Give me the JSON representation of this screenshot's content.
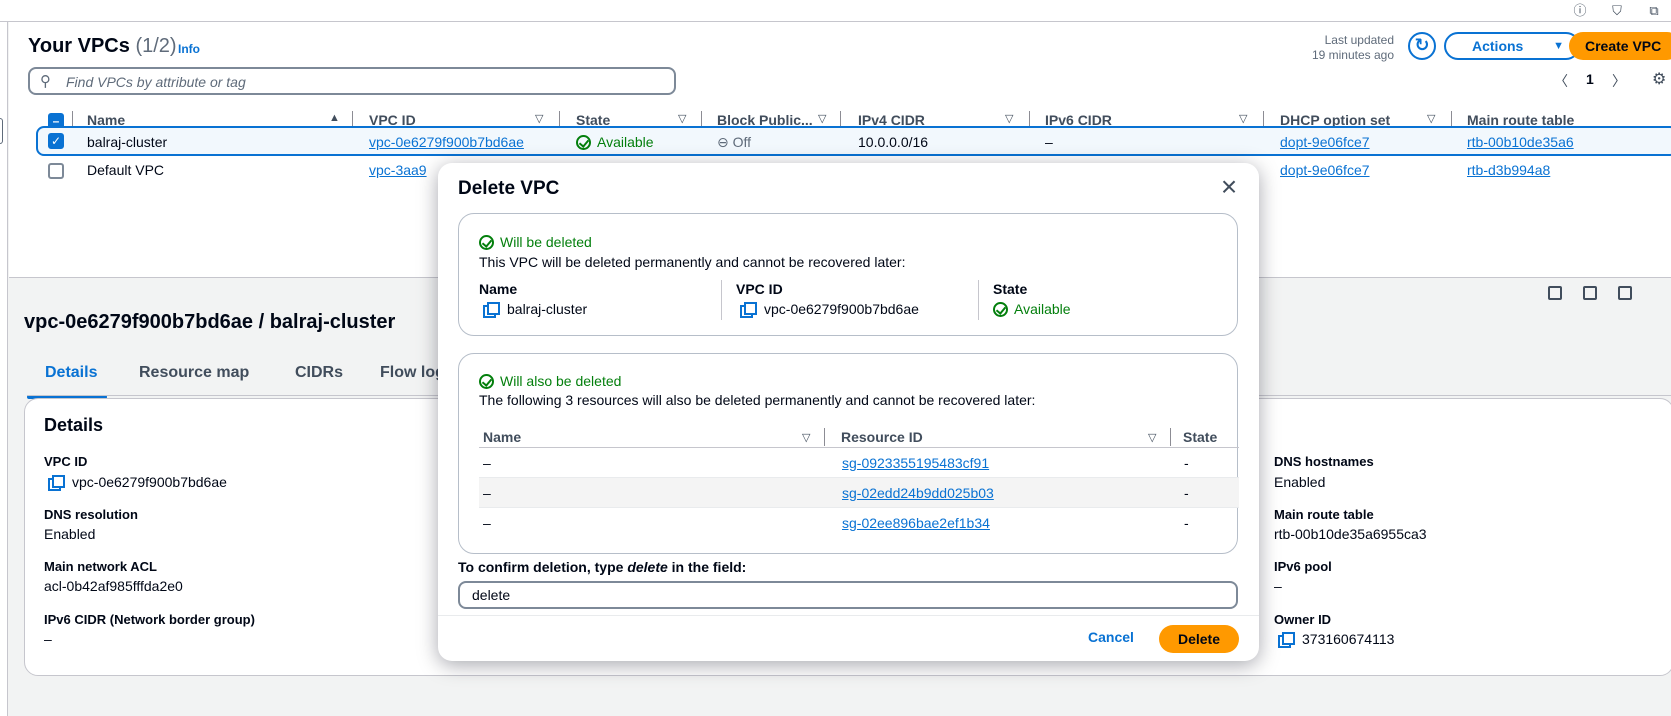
{
  "panel": {
    "title": "Your VPCs",
    "count": "(1/2)",
    "info": "Info",
    "last_updated_label": "Last updated",
    "last_updated_value": "19 minutes ago",
    "actions_label": "Actions",
    "create_label": "Create VPC",
    "search_placeholder": "Find VPCs by attribute or tag",
    "page": "1"
  },
  "table": {
    "columns": [
      "Name",
      "VPC ID",
      "State",
      "Block Public...",
      "IPv4 CIDR",
      "IPv6 CIDR",
      "DHCP option set",
      "Main route table"
    ],
    "rows": [
      {
        "selected": true,
        "name": "balraj-cluster",
        "vpc_id": "vpc-0e6279f900b7bd6ae",
        "state": "Available",
        "block": "Off",
        "ipv4": "10.0.0.0/16",
        "ipv6": "–",
        "dhcp": "dopt-9e06fce7",
        "route": "rtb-00b10de35a6"
      },
      {
        "selected": false,
        "name": "Default VPC",
        "vpc_id": "vpc-3aa9",
        "dhcp": "dopt-9e06fce7",
        "route": "rtb-d3b994a8"
      }
    ]
  },
  "detail": {
    "title": "vpc-0e6279f900b7bd6ae / balraj-cluster",
    "tabs": [
      "Details",
      "Resource map",
      "CIDRs",
      "Flow logs"
    ],
    "card_title": "Details",
    "fields": {
      "vpc_id_k": "VPC ID",
      "vpc_id_v": "vpc-0e6279f900b7bd6ae",
      "dns_res_k": "DNS resolution",
      "dns_res_v": "Enabled",
      "acl_k": "Main network ACL",
      "acl_v": "acl-0b42af985fffda2e0",
      "ipv6ng_k": "IPv6 CIDR (Network border group)",
      "ipv6ng_v": "–",
      "dns_host_k": "DNS hostnames",
      "dns_host_v": "Enabled",
      "mrt_k": "Main route table",
      "mrt_v": "rtb-00b10de35a6955ca3",
      "pool_k": "IPv6 pool",
      "pool_v": "–",
      "owner_k": "Owner ID",
      "owner_v": "373160674113"
    }
  },
  "modal": {
    "title": "Delete VPC",
    "box1": {
      "status": "Will be deleted",
      "desc": "This VPC will be deleted permanently and cannot be recovered later:",
      "name_k": "Name",
      "name_v": "balraj-cluster",
      "vpcid_k": "VPC ID",
      "vpcid_v": "vpc-0e6279f900b7bd6ae",
      "state_k": "State",
      "state_v": "Available"
    },
    "box2": {
      "status": "Will also be deleted",
      "desc": "The following 3 resources will also be deleted permanently and cannot be recovered later:",
      "columns": [
        "Name",
        "Resource ID",
        "State"
      ],
      "rows": [
        {
          "name": "–",
          "rid": "sg-0923355195483cf91",
          "state": "-"
        },
        {
          "name": "–",
          "rid": "sg-02edd24b9dd025b03",
          "state": "-"
        },
        {
          "name": "–",
          "rid": "sg-02ee896bae2ef1b34",
          "state": "-"
        }
      ]
    },
    "confirm_pre": "To confirm deletion, type ",
    "confirm_word": "delete",
    "confirm_post": " in the field:",
    "input_value": "delete",
    "cancel": "Cancel",
    "delete": "Delete"
  },
  "colors": {
    "accent": "#0972d3",
    "primary_button": "#ff9900",
    "success": "#037f0c"
  },
  "icons": [
    "info-icon",
    "shield-icon",
    "extension-icon",
    "refresh-icon",
    "search-icon",
    "settings-icon",
    "copy-icon",
    "check-circle-icon",
    "close-icon"
  ]
}
